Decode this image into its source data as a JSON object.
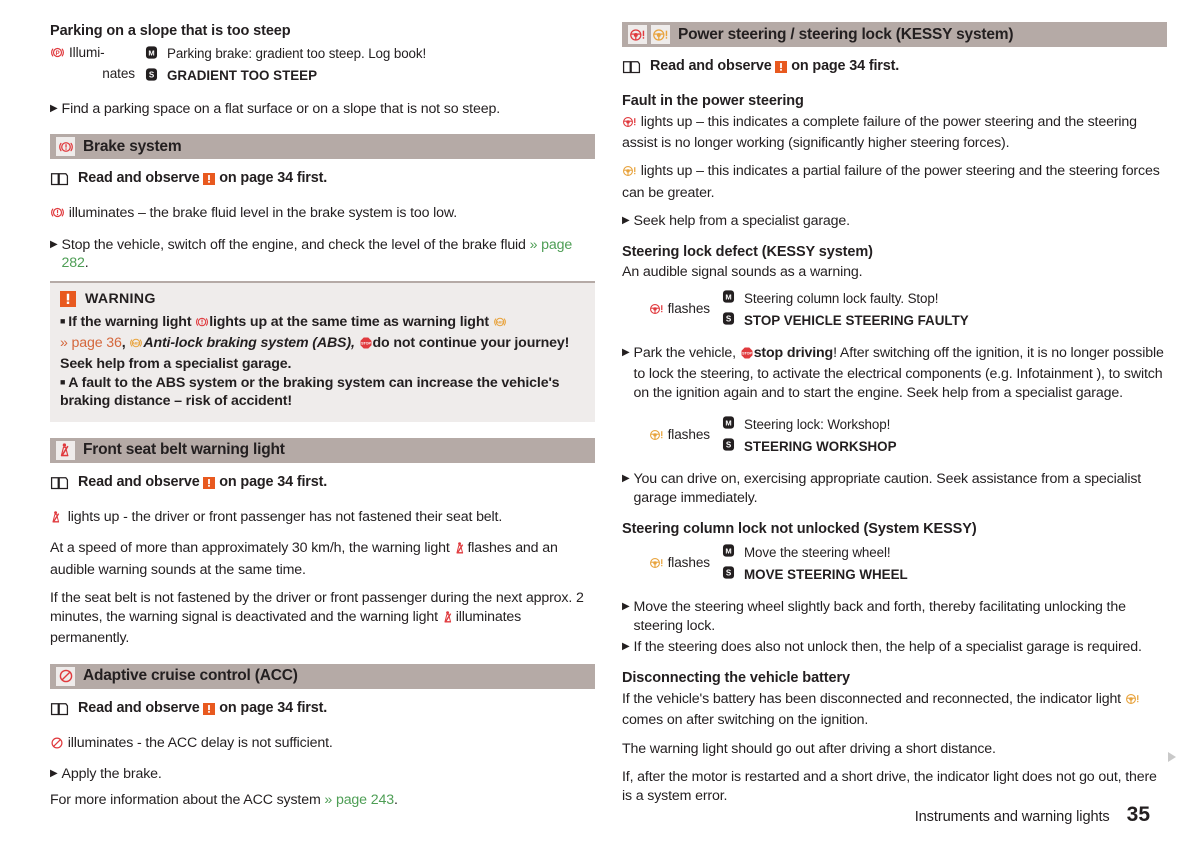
{
  "colors": {
    "section_bar_bg": "#b5aaa6",
    "box_bg": "#efeceb",
    "warning_orange": "#e8591f",
    "red_tell_tale": "#e03a3e",
    "amber_tell_tale": "#e8a33d",
    "cross_ref_green": "#4e9e55",
    "cross_ref_orange": "#d4673c",
    "text": "#231f20"
  },
  "left_column": {
    "parking_slope": {
      "heading": "Parking on a slope that is too steep",
      "state_icon": "parking-brake-warning-icon",
      "state_label_line1": "Illumi-",
      "state_label_line2": "nates",
      "messages": [
        {
          "icon": "maxidot-display-icon",
          "text": "Parking brake: gradient too steep. Log book!",
          "style": "normal"
        },
        {
          "icon": "segment-display-icon",
          "text": "GRADIENT TOO STEEP",
          "style": "caps"
        }
      ],
      "action": "Find a parking space on a flat surface or on a slope that is not so steep."
    },
    "brake_system": {
      "icon": "brake-system-warning-icon",
      "title": "Brake system",
      "read_observe_before": "Read and observe",
      "read_observe_after": "on page 34 first.",
      "statement_prefix_icon": "brake-system-warning-icon",
      "statement": "illuminates – the brake fluid level in the brake system is too low.",
      "action": "Stop the vehicle, switch off the engine, and check the level of the brake fluid",
      "action_ref": "» page 282",
      "warning": {
        "label": "WARNING",
        "b1_p1": "If the warning light",
        "b1_icon1": "brake-system-warning-icon",
        "b1_p2": "lights up at the same time as warning light",
        "b1_icon2": "abs-warning-icon",
        "b1_ref": "» page 36",
        "b1_p3": ",",
        "b1_icon3": "abs-warning-icon",
        "b1_italic": "Anti-lock braking system (ABS),",
        "b1_icon4": "stop-sign-icon",
        "b1_bold": "do not continue your journey!",
        "b1_p4": "Seek help from a specialist garage.",
        "b2": "A fault to the ABS system or the braking system can increase the vehicle's braking distance – risk of accident!"
      }
    },
    "seat_belt": {
      "icon": "seat-belt-warning-icon",
      "title": "Front seat belt warning light",
      "read_observe_before": "Read and observe",
      "read_observe_after": "on page 34 first.",
      "statement": "lights up - the driver or front passenger has not fastened their seat belt.",
      "para_2_a": "At a speed of more than approximately 30 km/h, the warning light",
      "para_2_b": "flashes and an audible warning sounds at the same time.",
      "para_3_a": "If the seat belt is not fastened by the driver or front passenger during the next approx. 2 minutes, the warning signal is deactivated and the warning light",
      "para_3_b": "illuminates permanently."
    },
    "acc": {
      "icon": "acc-warning-icon",
      "title": "Adaptive cruise control (ACC)",
      "read_observe_before": "Read and observe",
      "read_observe_after": "on page 34 first.",
      "statement": "illuminates - the ACC delay is not sufficient.",
      "action": "Apply the brake.",
      "more_info_before": "For more information about the ACC system",
      "more_info_ref": "» page 243",
      "more_info_after": "."
    }
  },
  "right_column": {
    "power_steering": {
      "icon_red": "power-steering-red-warning-icon",
      "icon_amber": "power-steering-amber-warning-icon",
      "title": "Power steering / steering lock (KESSY system)",
      "read_observe_before": "Read and observe",
      "read_observe_after": "on page 34 first.",
      "fault_heading": "Fault in the power steering",
      "fault_red": "lights up – this indicates a complete failure of the power steering and the steering assist is no longer working (significantly higher steering forces).",
      "fault_amber": "lights up – this indicates a partial failure of the power steering and the steering forces can be greater.",
      "fault_action": "Seek help from a specialist garage."
    },
    "steering_lock_defect": {
      "heading": "Steering lock defect (KESSY system)",
      "subtext": "An audible signal sounds as a warning.",
      "state_icon": "power-steering-red-warning-icon",
      "state_label": "flashes",
      "messages": [
        {
          "icon": "maxidot-display-icon",
          "text": "Steering column lock faulty. Stop!",
          "style": "normal"
        },
        {
          "icon": "segment-display-icon",
          "text": "STOP VEHICLE STEERING FAULTY",
          "style": "caps"
        }
      ],
      "action_a": "Park the vehicle,",
      "action_icon": "stop-sign-icon",
      "action_bold": "stop driving",
      "action_b": "! After switching off the ignition, it is no longer possible to lock the steering, to activate the electrical components (e.g. Infotainment ), to switch on the ignition again and to start the engine. Seek help from a specialist garage.",
      "state2_icon": "power-steering-amber-warning-icon",
      "state2_label": "flashes",
      "messages2": [
        {
          "icon": "maxidot-display-icon",
          "text": "Steering lock: Workshop!",
          "style": "normal"
        },
        {
          "icon": "segment-display-icon",
          "text": "STEERING WORKSHOP",
          "style": "caps"
        }
      ],
      "action2": "You can drive on, exercising appropriate caution. Seek assistance from a specialist garage immediately."
    },
    "steering_lock_not_unlocked": {
      "heading": "Steering column lock not unlocked (System KESSY)",
      "state_icon": "power-steering-amber-warning-icon",
      "state_label": "flashes",
      "messages": [
        {
          "icon": "maxidot-display-icon",
          "text": "Move the steering wheel!",
          "style": "normal"
        },
        {
          "icon": "segment-display-icon",
          "text": "MOVE STEERING WHEEL",
          "style": "caps"
        }
      ],
      "action_1": "Move the steering wheel slightly back and forth, thereby facilitating unlocking the steering lock.",
      "action_2": "If the steering does also not unlock then, the help of a specialist garage is required."
    },
    "battery": {
      "heading": "Disconnecting the vehicle battery",
      "para_1_a": "If the vehicle's battery has been disconnected and reconnected, the indicator light",
      "para_1_icon": "power-steering-amber-warning-icon",
      "para_1_b": "comes on after switching on the ignition.",
      "para_2": "The warning light should go out after driving a short distance.",
      "para_3": "If, after the motor is restarted and a short drive, the indicator light does not go out, there is a system error."
    }
  },
  "footer": {
    "chapter": "Instruments and warning lights",
    "page_number": "35"
  }
}
